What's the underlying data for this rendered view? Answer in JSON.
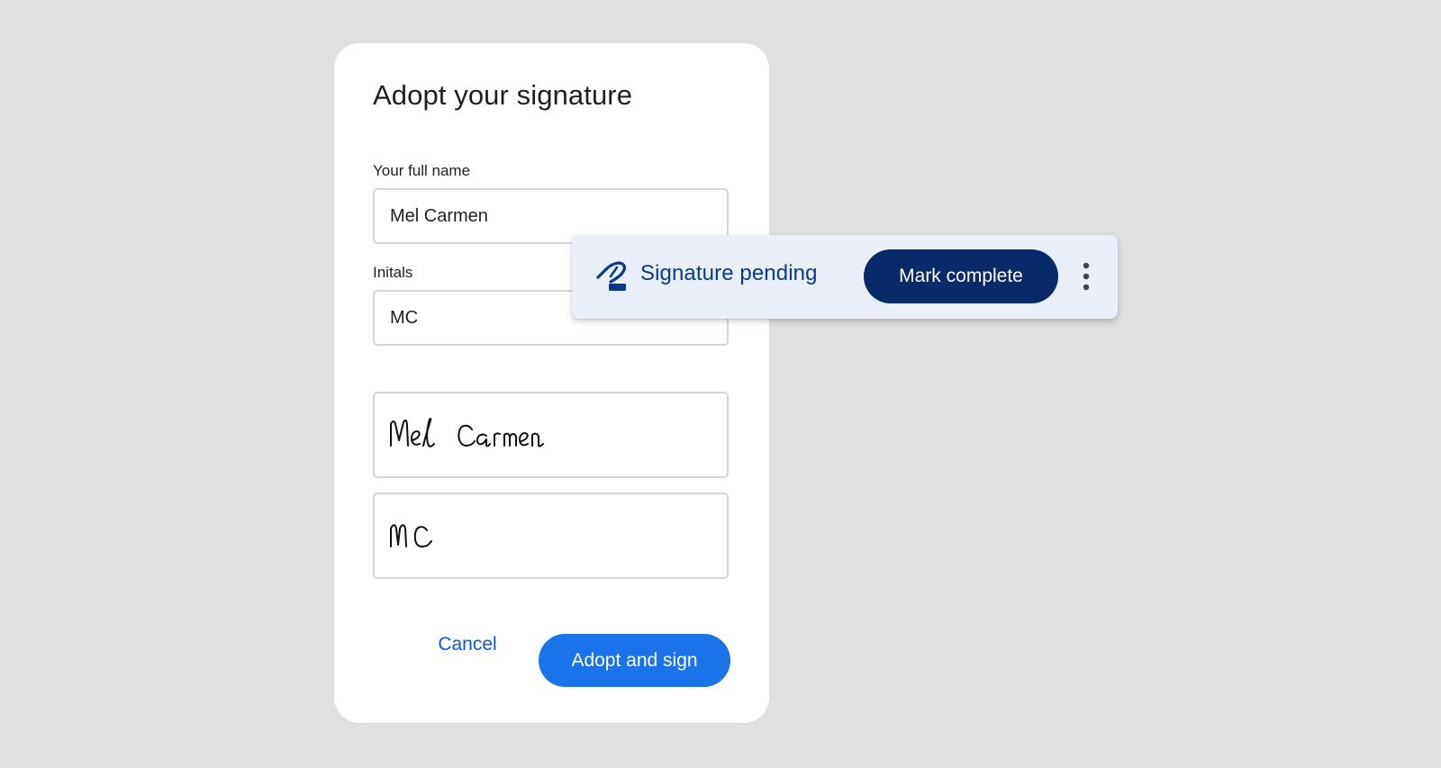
{
  "dialog": {
    "title": "Adopt your signature",
    "full_name_label": "Your full name",
    "full_name_value": "Mel Carmen",
    "initials_label": "Initals",
    "initials_value": "MC",
    "signature_preview": "Mel Carmen",
    "initials_preview": "MC",
    "cancel_label": "Cancel",
    "adopt_label": "Adopt and sign"
  },
  "status_chip": {
    "icon": "signature-pen-icon",
    "text": "Signature pending",
    "action_label": "Mark complete",
    "more_icon": "more-vert-icon"
  },
  "colors": {
    "background": "#e0e0e0",
    "primary": "#1a73e8",
    "link": "#0b57d0",
    "chip_background": "#e9eef8",
    "chip_text": "#0b3a8c",
    "chip_button": "#082a6b"
  }
}
